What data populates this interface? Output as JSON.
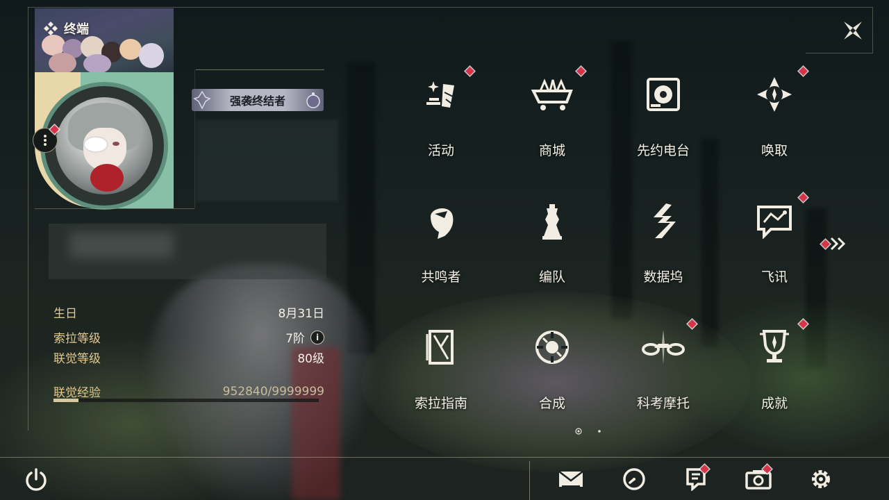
{
  "header": {
    "title": "终端"
  },
  "profile": {
    "title_badge": "强袭终结者",
    "stats": [
      {
        "label": "生日",
        "value": "8月31日"
      },
      {
        "label": "索拉等级",
        "value": "7阶"
      },
      {
        "label": "联觉等级",
        "value": "80级"
      }
    ],
    "exp": {
      "label": "联觉经验",
      "value": "952840/9999999",
      "progress": 0.0953
    }
  },
  "menu": {
    "items": [
      {
        "label": "活动",
        "icon": "activity-icon",
        "badge": true
      },
      {
        "label": "商城",
        "icon": "shop-cart-icon",
        "badge": true
      },
      {
        "label": "先约电台",
        "icon": "radio-icon",
        "badge": false
      },
      {
        "label": "唤取",
        "icon": "summon-compass-icon",
        "badge": true
      },
      {
        "label": "共鸣者",
        "icon": "resonator-head-icon",
        "badge": false
      },
      {
        "label": "编队",
        "icon": "team-chess-icon",
        "badge": false
      },
      {
        "label": "数据坞",
        "icon": "data-bank-icon",
        "badge": false
      },
      {
        "label": "飞讯",
        "icon": "chat-message-icon",
        "badge": true
      },
      {
        "label": "索拉指南",
        "icon": "guidebook-icon",
        "badge": false
      },
      {
        "label": "合成",
        "icon": "synthesis-icon",
        "badge": false
      },
      {
        "label": "科考摩托",
        "icon": "motorcycle-icon",
        "badge": true
      },
      {
        "label": "成就",
        "icon": "trophy-icon",
        "badge": true
      }
    ],
    "page_count": 2,
    "current_page": 1
  },
  "bottom_bar": {
    "buttons": [
      {
        "icon": "mail-icon",
        "badge": false
      },
      {
        "icon": "clock-icon",
        "badge": false
      },
      {
        "icon": "notice-icon",
        "badge": true
      },
      {
        "icon": "camera-icon",
        "badge": true
      },
      {
        "icon": "settings-gear-icon",
        "badge": false
      }
    ]
  },
  "colors": {
    "accent_gold": "#e4c98f",
    "badge_red": "#d9334a",
    "text": "#f4f0e6"
  }
}
